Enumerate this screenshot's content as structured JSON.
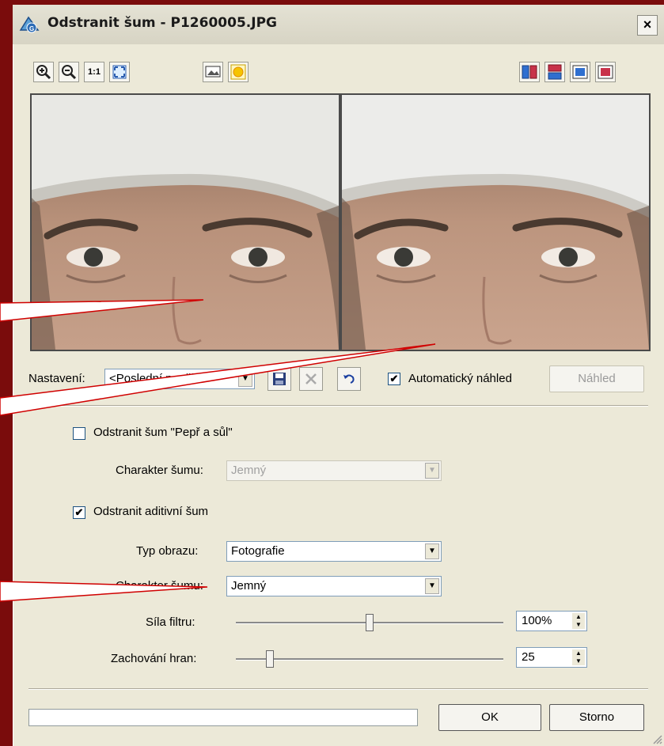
{
  "window": {
    "title": "Odstranit šum - P1260005.JPG",
    "close_glyph": "×"
  },
  "toolbar": {
    "zoom_in": "zoom-in-icon",
    "zoom_out": "zoom-out-icon",
    "actual_size": "1:1",
    "fit": "fit-window-icon",
    "view_modes": [
      "split-vertical-icon",
      "split-horizontal-icon",
      "original-only-icon",
      "result-only-icon"
    ]
  },
  "settings": {
    "label": "Nastavení:",
    "preset_value": "<Poslední použité>",
    "auto_preview_label": "Automatický náhled",
    "auto_preview_checked": true,
    "preview_button": "Náhled"
  },
  "salt_pepper": {
    "checkbox_label": "Odstranit šum \"Pepř a sůl\"",
    "checked": false,
    "character_label": "Charakter šumu:",
    "character_value": "Jemný"
  },
  "additive": {
    "checkbox_label": "Odstranit aditivní šum",
    "checked": true,
    "image_type_label": "Typ obrazu:",
    "image_type_value": "Fotografie",
    "character_label": "Charakter šumu:",
    "character_value": "Jemný",
    "filter_strength_label": "Síla filtru:",
    "filter_strength_value": "100%",
    "edge_label": "Zachování hran:",
    "edge_value": "25"
  },
  "footer": {
    "ok": "OK",
    "cancel": "Storno"
  },
  "colors": {
    "callout_line": "#d00000",
    "background": "#7a0c0c",
    "dialog": "#ece9d8"
  }
}
